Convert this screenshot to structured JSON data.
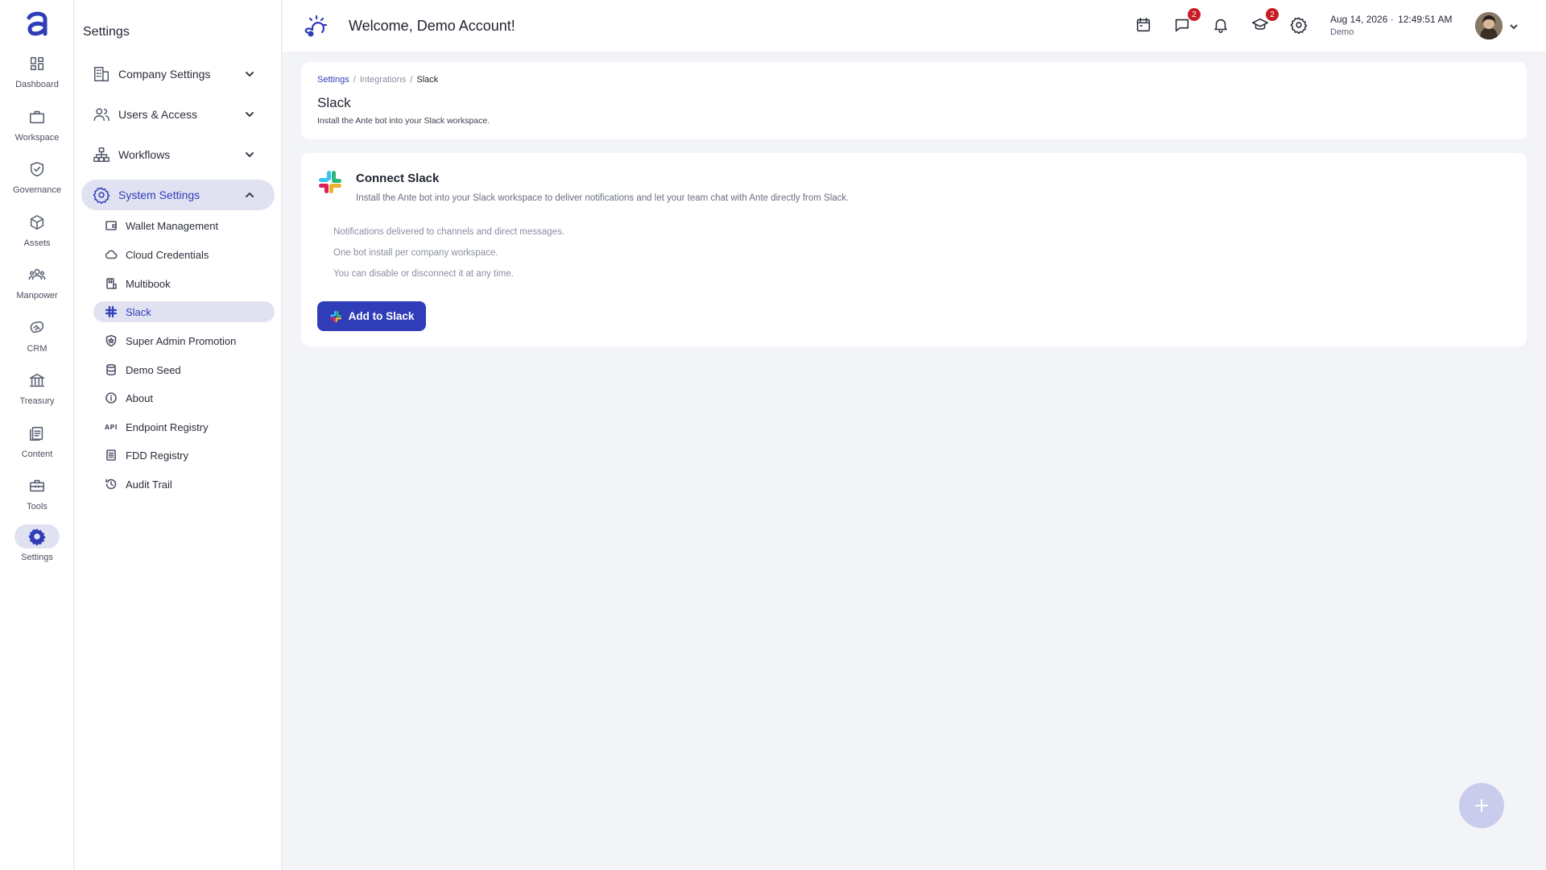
{
  "rail": {
    "items": [
      {
        "label": "Dashboard",
        "icon": "dashboard-icon"
      },
      {
        "label": "Workspace",
        "icon": "briefcase-icon"
      },
      {
        "label": "Governance",
        "icon": "shield-check-icon"
      },
      {
        "label": "Assets",
        "icon": "cube-icon"
      },
      {
        "label": "Manpower",
        "icon": "people-icon"
      },
      {
        "label": "CRM",
        "icon": "handshake-icon"
      },
      {
        "label": "Treasury",
        "icon": "bank-icon"
      },
      {
        "label": "Content",
        "icon": "document-icon"
      },
      {
        "label": "Tools",
        "icon": "toolbox-icon"
      },
      {
        "label": "Settings",
        "icon": "gear-icon"
      }
    ],
    "active": "Settings"
  },
  "sidebar": {
    "title": "Settings",
    "groups": [
      {
        "label": "Company Settings",
        "icon": "building-icon"
      },
      {
        "label": "Users & Access",
        "icon": "users-icon"
      },
      {
        "label": "Workflows",
        "icon": "sitemap-icon"
      },
      {
        "label": "System Settings",
        "icon": "gear-icon"
      }
    ],
    "subitems": [
      {
        "label": "Wallet Management",
        "icon": "wallet-icon"
      },
      {
        "label": "Cloud Credentials",
        "icon": "cloud-icon"
      },
      {
        "label": "Multibook",
        "icon": "book-icon"
      },
      {
        "label": "Slack",
        "icon": "hashtag-icon"
      },
      {
        "label": "Super Admin Promotion",
        "icon": "shield-star-icon"
      },
      {
        "label": "Demo Seed",
        "icon": "database-icon"
      },
      {
        "label": "About",
        "icon": "info-icon"
      },
      {
        "label": "Endpoint Registry",
        "icon": "api-icon",
        "glyph": "API"
      },
      {
        "label": "FDD Registry",
        "icon": "list-doc-icon"
      },
      {
        "label": "Audit Trail",
        "icon": "history-icon"
      }
    ]
  },
  "header": {
    "welcome": "Welcome, Demo Account!",
    "chat_badge": "2",
    "learn_badge": "2",
    "date": "Aug 14, 2026 ·",
    "time": "12:49:51 AM",
    "account": "Demo"
  },
  "page": {
    "breadcrumb": [
      "Settings",
      "Integrations",
      "Slack"
    ],
    "title": "Slack",
    "subtitle": "Install the Ante bot into your Slack workspace."
  },
  "connect": {
    "title": "Connect Slack",
    "description": "Install the Ante bot into your Slack workspace to deliver notifications and let your team chat with Ante directly from Slack.",
    "bullets": [
      "Notifications delivered to channels and direct messages.",
      "One bot install per company workspace.",
      "You can disable or disconnect it at any time."
    ],
    "button_label": "Add to Slack"
  },
  "colors": {
    "accent": "#2f3db8",
    "active_bg": "#e0e2f2",
    "badge": "#c81d25",
    "fab": "#c9ccec"
  }
}
